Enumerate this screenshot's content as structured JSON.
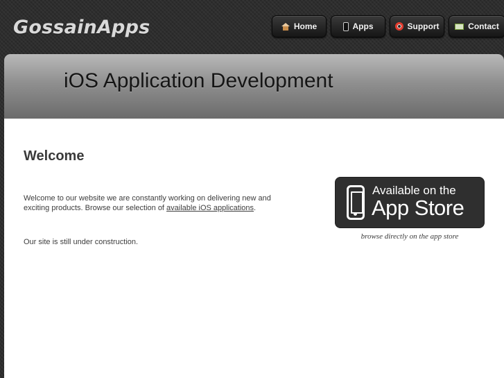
{
  "header": {
    "logo": "GossainApps",
    "nav": [
      {
        "label": "Home",
        "icon": "house-icon"
      },
      {
        "label": "Apps",
        "icon": "phone-icon"
      },
      {
        "label": "Support",
        "icon": "lifebuoy-icon"
      },
      {
        "label": "Contact",
        "icon": "mail-icon"
      }
    ]
  },
  "banner": {
    "title": "iOS Application Development"
  },
  "main": {
    "heading": "Welcome",
    "intro_text": "Welcome to our website we are constantly working on delivering new and exciting products. Browse our selection of ",
    "intro_link": "available iOS applications",
    "intro_end": ".",
    "note": "Our site is still under construction."
  },
  "appstore": {
    "line1": "Available on the",
    "line2": "App Store",
    "caption": "browse directly on the app store"
  },
  "colors": {
    "background": "#2d2d2d",
    "badge": "#2f2f2f",
    "text": "#3c3c3c"
  }
}
